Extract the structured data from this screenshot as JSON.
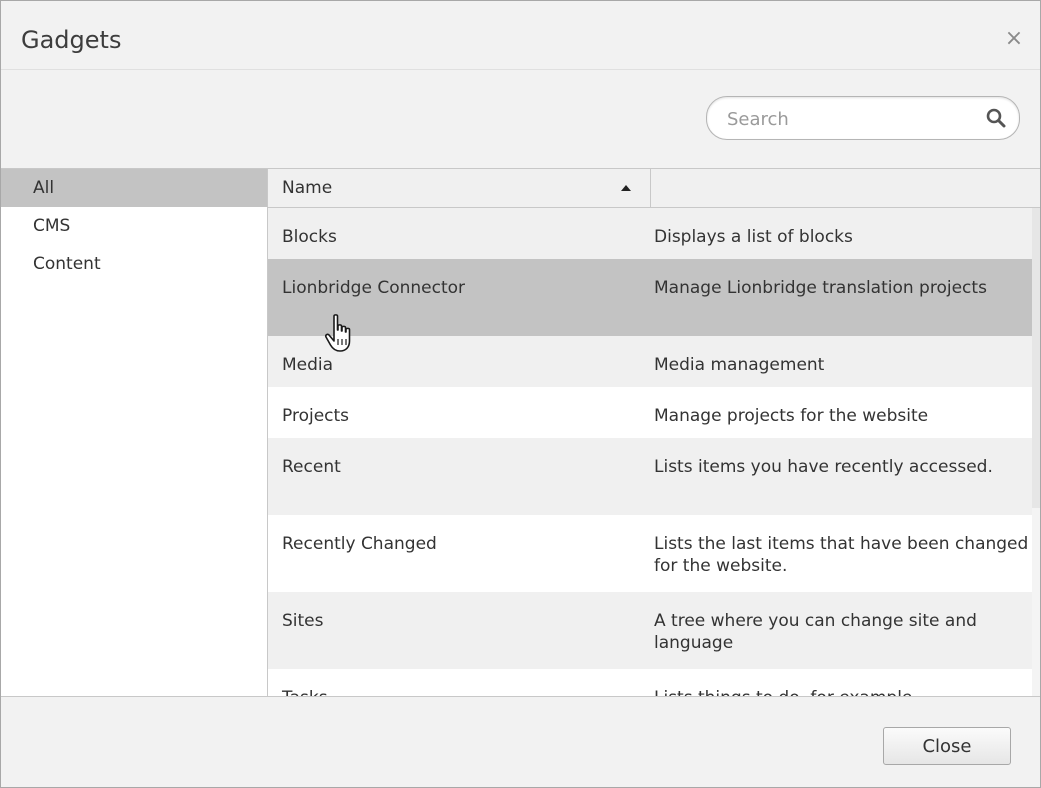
{
  "dialog": {
    "title": "Gadgets",
    "close_glyph": "×"
  },
  "search": {
    "placeholder": "Search",
    "value": "",
    "icon": "search-icon"
  },
  "categories": [
    {
      "label": "All",
      "active": true
    },
    {
      "label": "CMS",
      "active": false
    },
    {
      "label": "Content",
      "active": false
    }
  ],
  "table": {
    "columns": [
      {
        "label": "Name",
        "sorted": "ascending"
      },
      {
        "label": ""
      }
    ],
    "rows": [
      {
        "name": "Blocks",
        "description": "Displays a list of blocks"
      },
      {
        "name": "Lionbridge Connector",
        "description": "Manage Lionbridge translation projects",
        "hovered": true
      },
      {
        "name": "Media",
        "description": "Media management"
      },
      {
        "name": "Projects",
        "description": "Manage projects for the website"
      },
      {
        "name": "Recent",
        "description": "Lists items you have recently accessed."
      },
      {
        "name": "Recently Changed",
        "description": "Lists the last items that have been changed for the website."
      },
      {
        "name": "Sites",
        "description": "A tree where you can change site and language"
      },
      {
        "name": "Tasks",
        "description": "Lists things to do, for example"
      }
    ]
  },
  "footer": {
    "close_label": "Close"
  },
  "colors": {
    "header_bg": "#f2f2f2",
    "active_category": "#c3c3c3",
    "row_alt": "#f0f0f0",
    "row_hover": "#c3c3c3"
  }
}
